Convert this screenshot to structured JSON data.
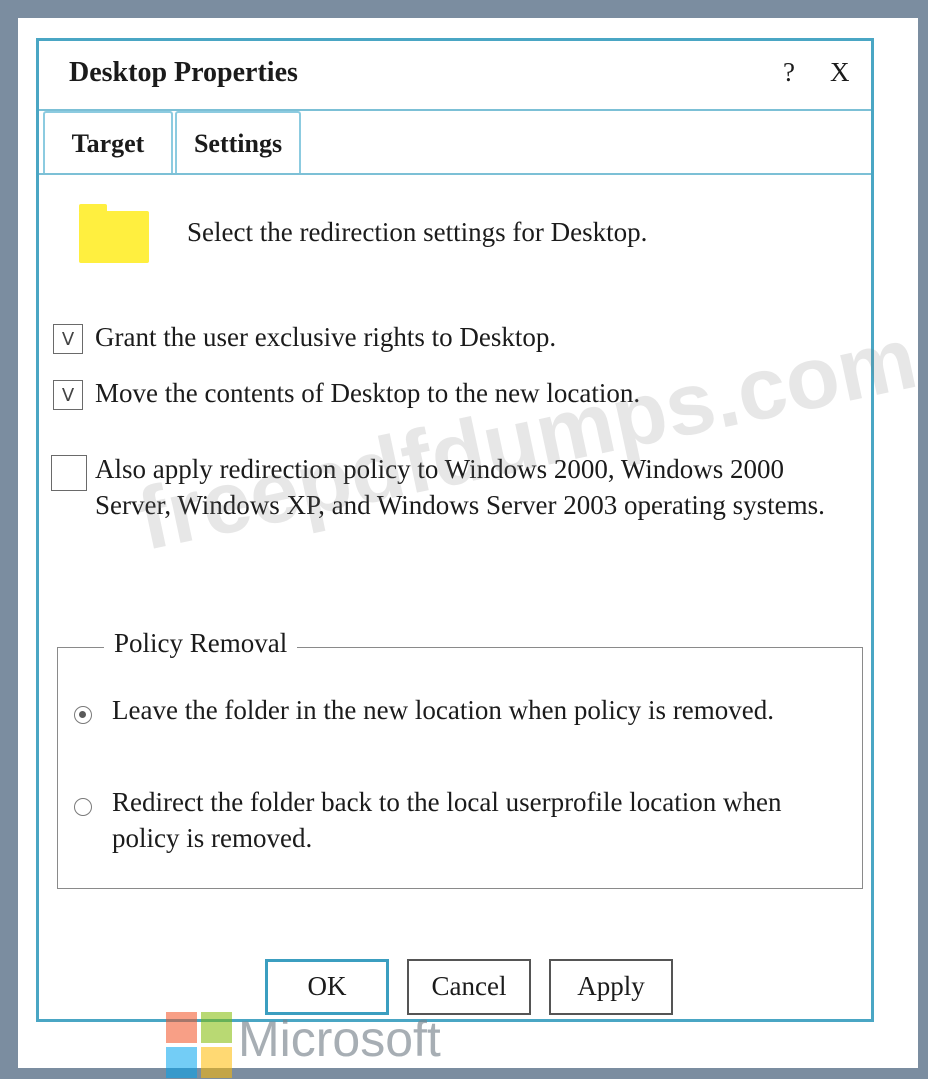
{
  "dialog": {
    "title": "Desktop Properties",
    "help_label": "?",
    "close_label": "X"
  },
  "tabs": [
    {
      "label": "Target",
      "active": true
    },
    {
      "label": "Settings",
      "active": false
    }
  ],
  "folder_icon": "folder-icon",
  "instruction": "Select the redirection settings for Desktop.",
  "options": [
    {
      "label": "Grant the user exclusive rights to Desktop.",
      "checked": true,
      "mark": "V"
    },
    {
      "label": "Move the contents of Desktop to the new location.",
      "checked": true,
      "mark": "V"
    },
    {
      "label": "Also apply redirection policy to Windows 2000, Windows 2000 Server, Windows XP, and Windows Server 2003 operating systems.",
      "checked": false,
      "mark": ""
    }
  ],
  "policy_removal": {
    "legend": "Policy Removal",
    "options": [
      {
        "label": "Leave the folder in the new location when policy is removed.",
        "selected": true
      },
      {
        "label": "Redirect the folder back to the local userprofile location when policy is removed.",
        "selected": false
      }
    ]
  },
  "buttons": {
    "ok": "OK",
    "cancel": "Cancel",
    "apply": "Apply"
  },
  "watermark": "freepdfdumps.com",
  "brand": {
    "logo_text": "Microsoft",
    "colors": [
      "#f25022",
      "#7fba00",
      "#00a4ef",
      "#ffb900"
    ]
  },
  "colors": {
    "accent": "#4aa6c4",
    "folder": "#ffef3f",
    "background": "#7b8da0"
  }
}
